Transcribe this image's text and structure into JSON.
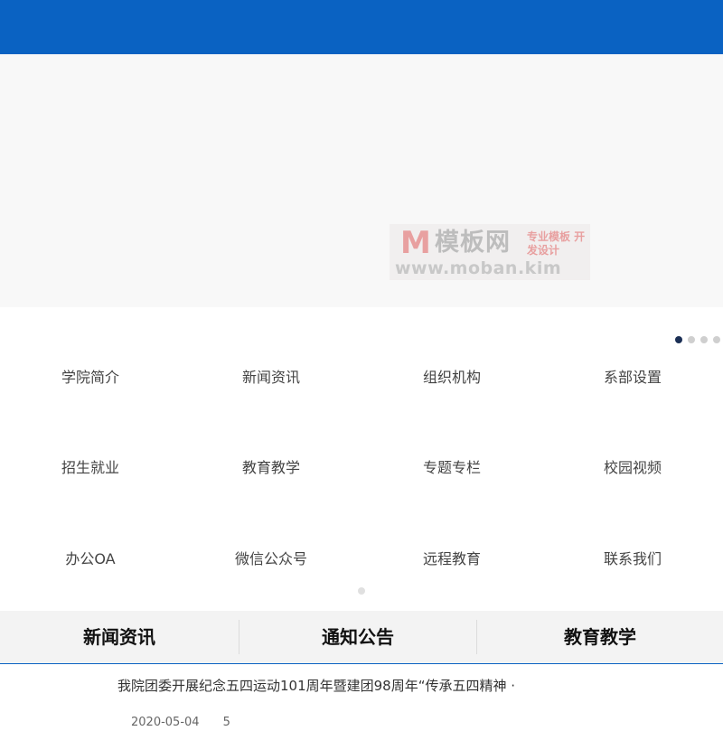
{
  "watermark": {
    "logo_letter": "M",
    "logo_text": "模板网",
    "tagline": "专业模板 开发设计",
    "url": "www.moban.kim"
  },
  "carousel": {
    "slide_count": 4,
    "active_index": 0
  },
  "nav_grid": {
    "items": [
      {
        "label": "学院简介"
      },
      {
        "label": "新闻资讯"
      },
      {
        "label": "组织机构"
      },
      {
        "label": "系部设置"
      },
      {
        "label": "招生就业"
      },
      {
        "label": "教育教学"
      },
      {
        "label": "专题专栏"
      },
      {
        "label": "校园视频"
      },
      {
        "label": "办公OA"
      },
      {
        "label": "微信公众号"
      },
      {
        "label": "远程教育"
      },
      {
        "label": "联系我们"
      }
    ],
    "page_count": 1
  },
  "tabs": [
    {
      "label": "新闻资讯"
    },
    {
      "label": "通知公告"
    },
    {
      "label": "教育教学"
    }
  ],
  "news": [
    {
      "title": "我院团委开展纪念五四运动101周年暨建团98周年“传承五四精神 ·",
      "date": "2020-05-04",
      "views": "5"
    }
  ],
  "colors": {
    "primary": "#0a62c2",
    "active_dot": "#1b2f55"
  }
}
